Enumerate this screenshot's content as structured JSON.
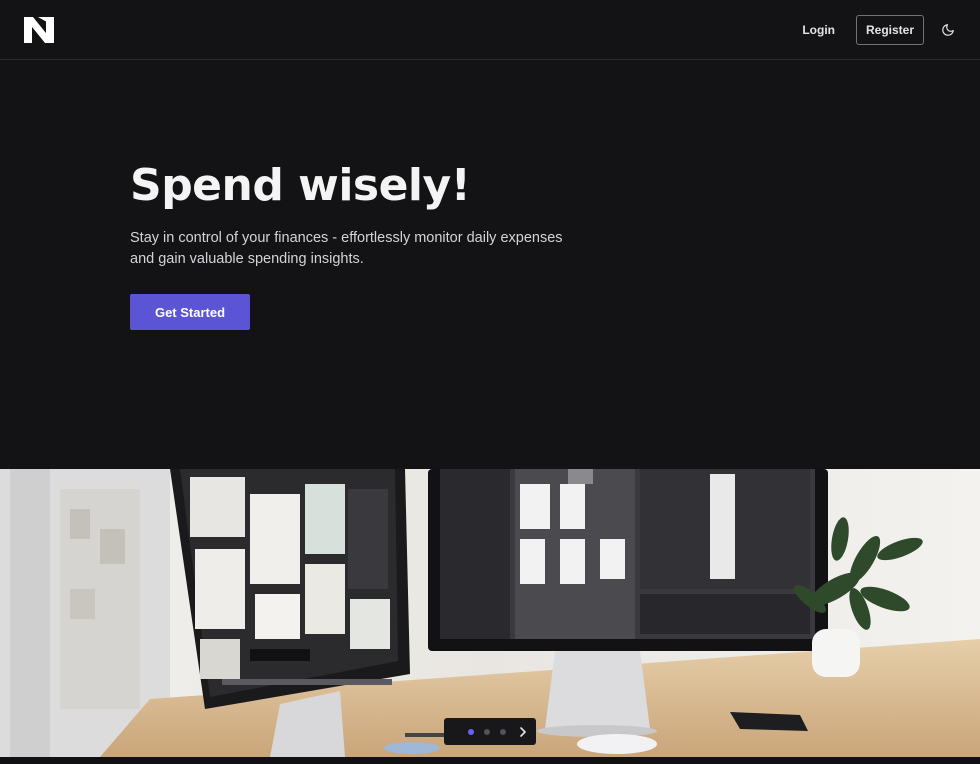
{
  "nav": {
    "logo_icon": "n-logo-icon",
    "login_label": "Login",
    "register_label": "Register",
    "theme_icon": "moon-icon"
  },
  "hero": {
    "title": "Spend wisely!",
    "subtitle": "Stay in control of your finances - effortlessly monitor daily expenses and gain valuable spending insights.",
    "cta_label": "Get Started"
  },
  "carousel": {
    "slide_count": 3,
    "active_slide": 1,
    "next_icon": "chevron-right-icon"
  },
  "colors": {
    "background": "#131316",
    "accent": "#5b55d6",
    "active_dot": "#6366f1"
  }
}
